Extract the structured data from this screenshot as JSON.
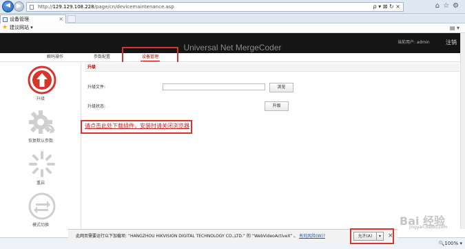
{
  "browser": {
    "url_prefix": "http://",
    "url_host": "129.129.108.228",
    "url_path": "/page/cn/devicemaintenance.asp",
    "url_tools": "ρ ▾ ⊠ ↻ ×",
    "tab_title": "设备管理",
    "favorites_item": "建议网站 ▾",
    "page_menu": "▤ ▾",
    "zoom": "🔍100% ▾"
  },
  "header": {
    "brand": "Universal Net MergeCoder",
    "current_user": "当前用户: admin",
    "logout": "注销"
  },
  "menu": {
    "items": [
      "解码操作",
      "参数配置",
      "设备管理"
    ],
    "active_index": 2
  },
  "sidebar": {
    "items": [
      {
        "label": "升级",
        "icon": "upgrade-arrow-icon",
        "active": true
      },
      {
        "label": "恢复默认参数",
        "icon": "gear-reset-icon",
        "active": false
      },
      {
        "label": "重启",
        "icon": "restart-spinner-icon",
        "active": false
      },
      {
        "label": "模式切换",
        "icon": "mode-switch-icon",
        "active": false
      }
    ]
  },
  "content": {
    "section_title": "升级",
    "file_label": "升级文件:",
    "file_value": "",
    "browse_button": "浏览",
    "status_label": "升级状态:",
    "upgrade_button": "升级",
    "download_link": "请点击此处下载插件，安装时请关闭浏览器"
  },
  "notification": {
    "message_prefix": "此网页需要运行以下加载项: “HANGZHOU HIKVISION DIGITAL TECHNOLOGY CO.,LTD.” 的 “WebVideoActiveX” 。",
    "risk_link": "有何风险(W)?",
    "allow_button": "允许(A)",
    "dropdown": "▾",
    "close": "×"
  },
  "watermark": {
    "text": "Bai 经验",
    "sub": "jingyan.baidu.com"
  },
  "colors": {
    "accent_red": "#c00000",
    "highlight_box": "#d9342b",
    "header_bg": "#151515"
  }
}
